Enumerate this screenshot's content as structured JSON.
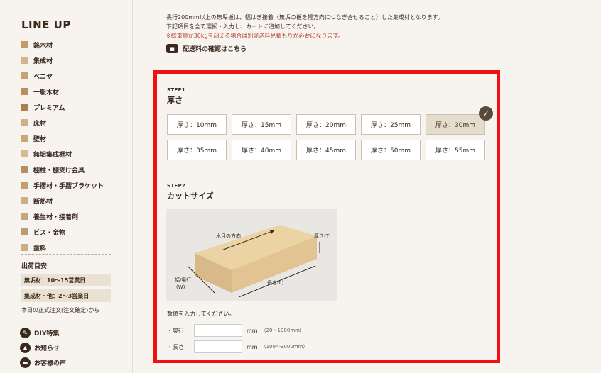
{
  "sidebar": {
    "title": "LINE UP",
    "items": [
      {
        "label": "銘木材",
        "swatch": "#c29a6b"
      },
      {
        "label": "集成材",
        "swatch": "#d3b48c"
      },
      {
        "label": "ベニヤ",
        "swatch": "#c8a274"
      },
      {
        "label": "一般木材",
        "swatch": "#b98f60"
      },
      {
        "label": "プレミアム",
        "swatch": "#a9804f"
      },
      {
        "label": "床材",
        "swatch": "#d0b088"
      },
      {
        "label": "壁材",
        "swatch": "#c9a578"
      },
      {
        "label": "無垢集成棚材",
        "swatch": "#d6ba93"
      },
      {
        "label": "棚柱・棚受け金具",
        "swatch": "#b48d63"
      },
      {
        "label": "手摺材・手摺ブラケット",
        "swatch": "#c49d70"
      },
      {
        "label": "断熱材",
        "swatch": "#cfae83"
      },
      {
        "label": "養生材・接着剤",
        "swatch": "#c7a579"
      },
      {
        "label": "ビス・金物",
        "swatch": "#bf9b70"
      },
      {
        "label": "塗料",
        "swatch": "#cdad86"
      }
    ],
    "shipping": {
      "title": "出荷目安",
      "rows": [
        "無垢材：10～15営業日",
        "集成材・他：2～3営業日"
      ],
      "note": "本日の正式注文(注文確定)から"
    },
    "links": [
      {
        "label": "DIY特集",
        "icon": "wrench-icon"
      },
      {
        "label": "お知らせ",
        "icon": "tree-icon"
      },
      {
        "label": "お客様の声",
        "icon": "chat-icon"
      }
    ]
  },
  "notes": {
    "line1": "長行200mm以上の無垢板は、幅はぎ接着（無垢の板を幅方向につなぎ合せること）した集成材となります。",
    "line2": "下記項目を全て選択・入力し、カートに追加してください。",
    "line3": "※総重量が30kgを超える場合は別途送料見積もりが必要になります。"
  },
  "shipping_link": "配送料の確認はこちら",
  "step1": {
    "label": "STEP1",
    "title": "厚さ",
    "options": [
      "厚さ：10mm",
      "厚さ：15mm",
      "厚さ：20mm",
      "厚さ：25mm",
      "厚さ：30mm",
      "厚さ：35mm",
      "厚さ：40mm",
      "厚さ：45mm",
      "厚さ：50mm",
      "厚さ：55mm"
    ],
    "selected": "厚さ：30mm"
  },
  "step2": {
    "label": "STEP2",
    "title": "カットサイズ",
    "diagram": {
      "grain": "木目の方向",
      "thickness": "厚さ(T)",
      "width_line1": "幅/奥行",
      "width_line2": "(W)",
      "length": "長さ(L)"
    },
    "instruction": "数値を入力してください。",
    "fields": [
      {
        "label": "・奥行",
        "unit": "mm",
        "range": "（20～1000mm）",
        "value": ""
      },
      {
        "label": "・長さ",
        "unit": "mm",
        "range": "（100～3000mm）",
        "value": ""
      }
    ]
  }
}
